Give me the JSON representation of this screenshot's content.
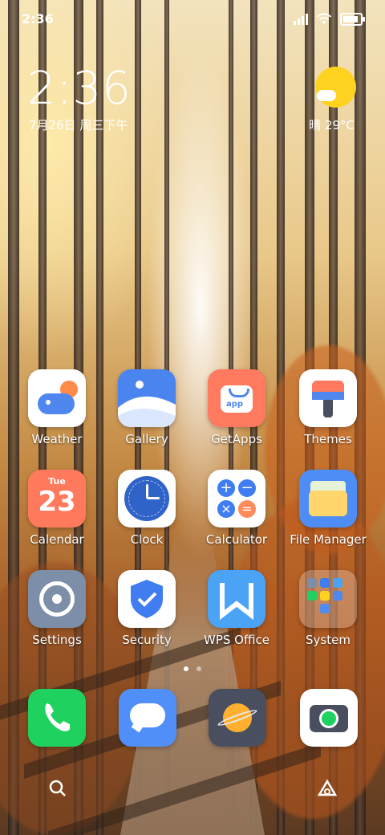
{
  "status_bar": {
    "time": "2:36",
    "icons": [
      "signal-icon",
      "wifi-icon",
      "battery-icon"
    ]
  },
  "clock_widget": {
    "time": "2:36",
    "date": "7月26日 周三下午"
  },
  "weather_widget": {
    "text": "晴 29°C",
    "icon": "sun-cloud-icon"
  },
  "apps": [
    {
      "label": "Weather",
      "icon": "weather-icon"
    },
    {
      "label": "Gallery",
      "icon": "gallery-icon"
    },
    {
      "label": "GetApps",
      "icon": "getapps-icon"
    },
    {
      "label": "Themes",
      "icon": "themes-icon"
    },
    {
      "label": "Calendar",
      "icon": "calendar-icon",
      "badge_day": "Tue",
      "badge_date": "23"
    },
    {
      "label": "Clock",
      "icon": "clock-icon"
    },
    {
      "label": "Calculator",
      "icon": "calculator-icon"
    },
    {
      "label": "File Manager",
      "icon": "file-manager-icon"
    },
    {
      "label": "Settings",
      "icon": "settings-icon"
    },
    {
      "label": "Security",
      "icon": "security-icon"
    },
    {
      "label": "WPS Office",
      "icon": "wps-office-icon"
    },
    {
      "label": "System",
      "icon": "system-folder-icon"
    }
  ],
  "page_indicator": {
    "pages": 2,
    "current": 1
  },
  "dock": [
    {
      "name": "phone",
      "icon": "phone-icon"
    },
    {
      "name": "messages",
      "icon": "messages-icon"
    },
    {
      "name": "browser",
      "icon": "browser-icon"
    },
    {
      "name": "camera",
      "icon": "camera-icon"
    }
  ],
  "nav": [
    {
      "name": "search",
      "icon": "search-icon"
    },
    {
      "name": "assistant",
      "icon": "assistant-icon"
    }
  ],
  "colors": {
    "sun": "#ffd21f",
    "weather_bg": "#ffffff",
    "gallery_bg": "#4a85ef",
    "getapps_bg": "#ff7a5e",
    "calendar_bg": "#ff7a5c",
    "clock_bg": "#2f63c7",
    "calculator_blue": "#3f7df0",
    "calculator_orange": "#ff8a5a",
    "file_manager_bg": "#4d8df5",
    "settings_bg": "#7c8ea8",
    "security_blue": "#3f7df0",
    "wps_bg": "#4aa3f5",
    "phone_bg": "#1fd15f",
    "messages_bg": "#4f8ff7",
    "browser_bg": "#4a4f60",
    "camera_bg": "#ffffff"
  }
}
